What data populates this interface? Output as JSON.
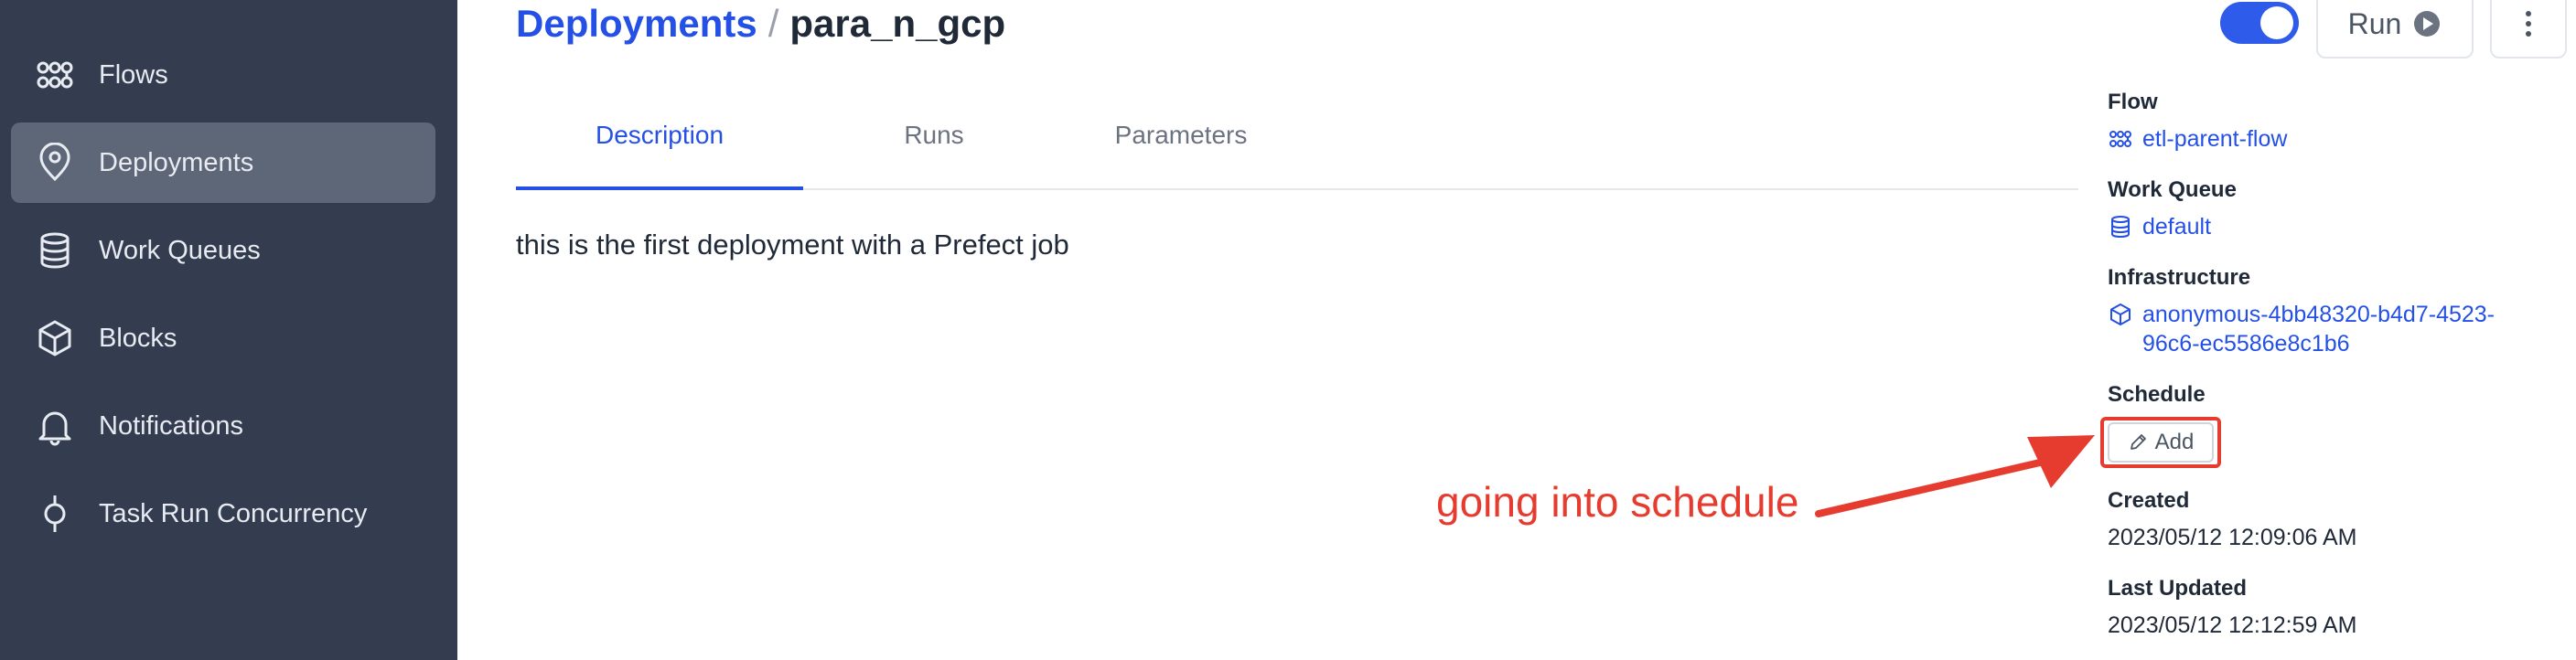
{
  "sidebar": {
    "items": [
      {
        "label": "Flows",
        "icon": "flows-icon",
        "active": false
      },
      {
        "label": "Deployments",
        "icon": "location-pin-icon",
        "active": true
      },
      {
        "label": "Work Queues",
        "icon": "database-icon",
        "active": false
      },
      {
        "label": "Blocks",
        "icon": "cube-icon",
        "active": false
      },
      {
        "label": "Notifications",
        "icon": "bell-icon",
        "active": false
      },
      {
        "label": "Task Run Concurrency",
        "icon": "concurrency-icon",
        "active": false
      }
    ]
  },
  "header": {
    "breadcrumb_link": "Deployments",
    "separator": "/",
    "current": "para_n_gcp",
    "run_label": "Run",
    "toggle_on": true
  },
  "tabs": [
    {
      "label": "Description",
      "active": true
    },
    {
      "label": "Runs",
      "active": false
    },
    {
      "label": "Parameters",
      "active": false
    }
  ],
  "description": "this is the first deployment with a Prefect job",
  "details": {
    "flow_label": "Flow",
    "flow_value": "etl-parent-flow",
    "work_queue_label": "Work Queue",
    "work_queue_value": "default",
    "infrastructure_label": "Infrastructure",
    "infrastructure_value": "anonymous-4bb48320-b4d7-4523-96c6-ec5586e8c1b6",
    "schedule_label": "Schedule",
    "schedule_add_label": "Add",
    "created_label": "Created",
    "created_value": "2023/05/12 12:09:06 AM",
    "last_updated_label": "Last Updated",
    "last_updated_value": "2023/05/12 12:12:59 AM"
  },
  "annotation": {
    "text": "going into schedule",
    "color": "#e63c2f"
  },
  "colors": {
    "sidebar_bg": "#333d4f",
    "sidebar_active": "#5e6778",
    "accent": "#2450e6"
  }
}
